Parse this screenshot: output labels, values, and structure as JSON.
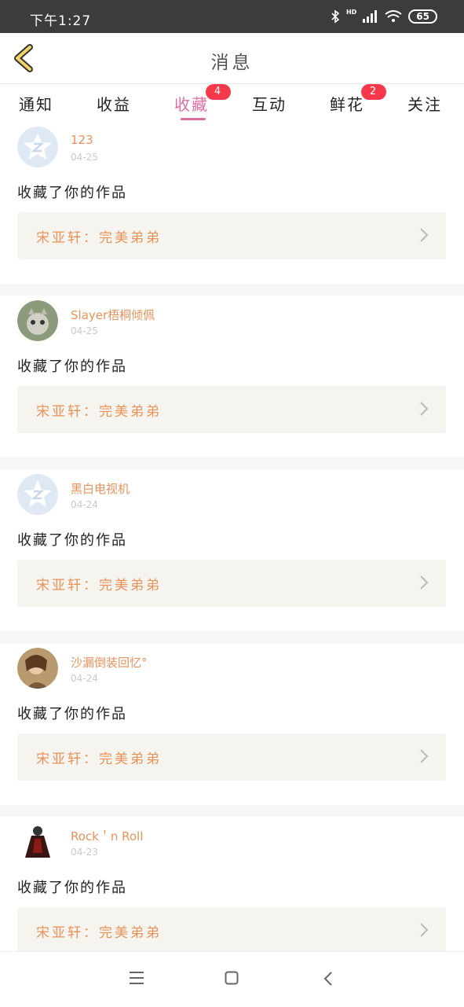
{
  "status_bar": {
    "time": "下午1:27",
    "battery": "65",
    "network": "HD"
  },
  "header": {
    "title": "消息"
  },
  "tabs": [
    {
      "label": "通知"
    },
    {
      "label": "收益"
    },
    {
      "label": "收藏",
      "badge": "4"
    },
    {
      "label": "互动"
    },
    {
      "label": "鲜花",
      "badge": "2"
    },
    {
      "label": "关注"
    }
  ],
  "notifications": [
    {
      "username": "123",
      "date": "04-25",
      "action": "收藏了你的作品",
      "work": "宋亚轩：完美弟弟"
    },
    {
      "username": "Slayer梧桐倾佩",
      "date": "04-25",
      "action": "收藏了你的作品",
      "work": "宋亚轩：完美弟弟"
    },
    {
      "username": "黑白电视机",
      "date": "04-24",
      "action": "收藏了你的作品",
      "work": "宋亚轩：完美弟弟"
    },
    {
      "username": "沙漏倒装回忆°",
      "date": "04-24",
      "action": "收藏了你的作品",
      "work": "宋亚轩：完美弟弟"
    },
    {
      "username": "Rock＇n Roll",
      "date": "04-23",
      "action": "收藏了你的作品",
      "work": "宋亚轩：完美弟弟"
    }
  ],
  "colors": {
    "accent": "#e06ba0",
    "username": "#e8925a",
    "badge": "#f4394a",
    "card_bg": "#f5f4ee"
  }
}
